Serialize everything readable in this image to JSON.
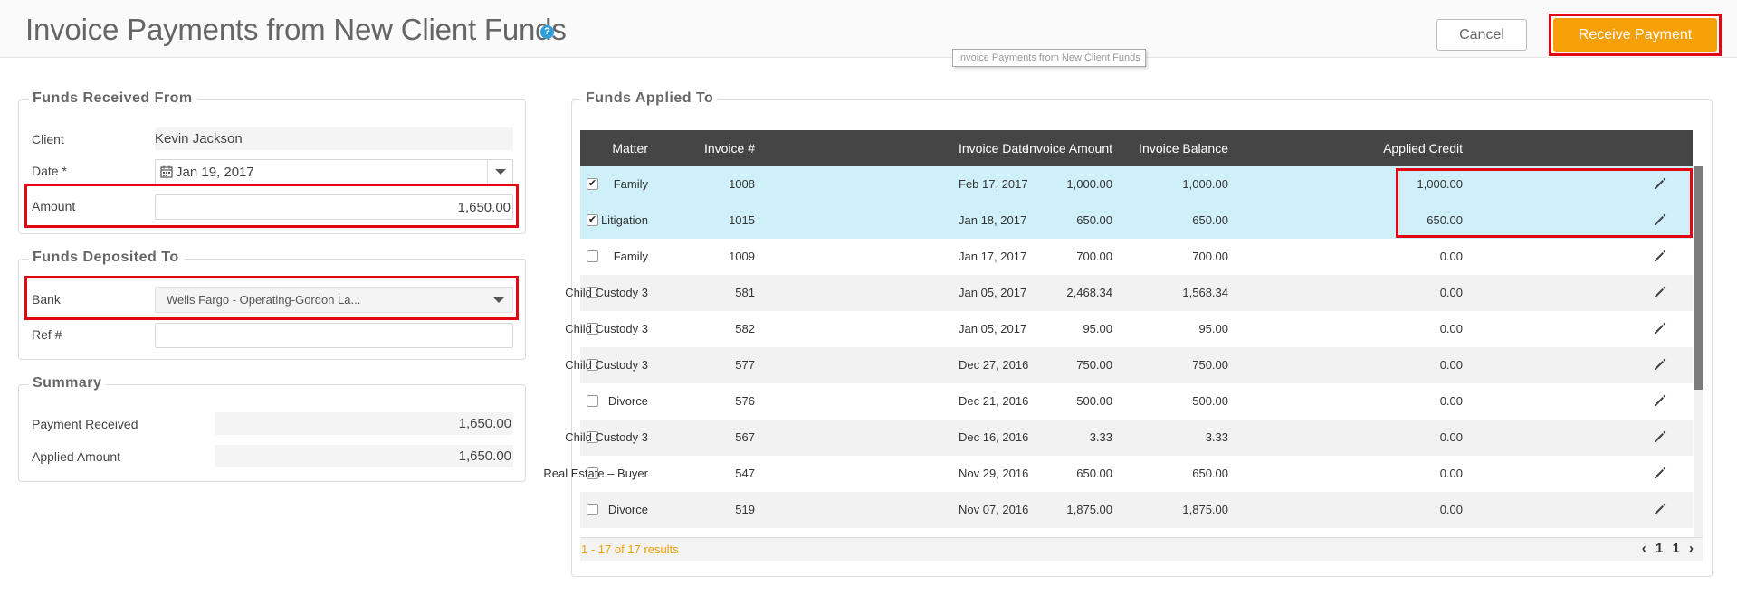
{
  "header": {
    "title": "Invoice Payments from New Client Funds",
    "help_icon": "question-circle-icon",
    "tooltip": "Invoice Payments from New Client Funds",
    "cancel_label": "Cancel",
    "receive_label": "Receive Payment"
  },
  "funds_received": {
    "legend": "Funds Received From",
    "client_label": "Client",
    "client_value": "Kevin Jackson",
    "date_label": "Date *",
    "date_value": "Jan 19, 2017",
    "amount_label": "Amount",
    "amount_value": "1,650.00"
  },
  "funds_deposited": {
    "legend": "Funds Deposited To",
    "bank_label": "Bank",
    "bank_value": "Wells Fargo - Operating-Gordon La...",
    "ref_label": "Ref #",
    "ref_value": ""
  },
  "summary": {
    "legend": "Summary",
    "payment_received_label": "Payment Received",
    "payment_received_value": "1,650.00",
    "applied_amount_label": "Applied Amount",
    "applied_amount_value": "1,650.00"
  },
  "funds_applied": {
    "legend": "Funds Applied To",
    "columns": {
      "matter": "Matter",
      "invoice_no": "Invoice #",
      "invoice_date": "Invoice Date",
      "invoice_amount": "Invoice Amount",
      "invoice_balance": "Invoice Balance",
      "applied_credit": "Applied Credit"
    },
    "rows": [
      {
        "checked": true,
        "matter": "Family",
        "invoice_no": "1008",
        "invoice_date": "Feb 17, 2017",
        "amount": "1,000.00",
        "balance": "1,000.00",
        "applied": "1,000.00"
      },
      {
        "checked": true,
        "matter": "Litigation",
        "invoice_no": "1015",
        "invoice_date": "Jan 18, 2017",
        "amount": "650.00",
        "balance": "650.00",
        "applied": "650.00"
      },
      {
        "checked": false,
        "matter": "Family",
        "invoice_no": "1009",
        "invoice_date": "Jan 17, 2017",
        "amount": "700.00",
        "balance": "700.00",
        "applied": "0.00"
      },
      {
        "checked": false,
        "matter": "Child Custody 3",
        "invoice_no": "581",
        "invoice_date": "Jan 05, 2017",
        "amount": "2,468.34",
        "balance": "1,568.34",
        "applied": "0.00"
      },
      {
        "checked": false,
        "matter": "Child Custody 3",
        "invoice_no": "582",
        "invoice_date": "Jan 05, 2017",
        "amount": "95.00",
        "balance": "95.00",
        "applied": "0.00"
      },
      {
        "checked": false,
        "matter": "Child Custody 3",
        "invoice_no": "577",
        "invoice_date": "Dec 27, 2016",
        "amount": "750.00",
        "balance": "750.00",
        "applied": "0.00"
      },
      {
        "checked": false,
        "matter": "Divorce",
        "invoice_no": "576",
        "invoice_date": "Dec 21, 2016",
        "amount": "500.00",
        "balance": "500.00",
        "applied": "0.00"
      },
      {
        "checked": false,
        "matter": "Child Custody 3",
        "invoice_no": "567",
        "invoice_date": "Dec 16, 2016",
        "amount": "3.33",
        "balance": "3.33",
        "applied": "0.00"
      },
      {
        "checked": false,
        "matter": "Real Estate – Buyer",
        "invoice_no": "547",
        "invoice_date": "Nov 29, 2016",
        "amount": "650.00",
        "balance": "650.00",
        "applied": "0.00"
      },
      {
        "checked": false,
        "matter": "Divorce",
        "invoice_no": "519",
        "invoice_date": "Nov 07, 2016",
        "amount": "1,875.00",
        "balance": "1,875.00",
        "applied": "0.00"
      }
    ],
    "results_text": "1 - 17 of 17 results",
    "pager": {
      "prev": "‹",
      "page_a": "1",
      "page_b": "1",
      "next": "›"
    }
  },
  "colors": {
    "accent": "#f5a007",
    "highlight_box": "#e30613",
    "selected_row": "#d0f0f9",
    "table_header": "#454545"
  }
}
